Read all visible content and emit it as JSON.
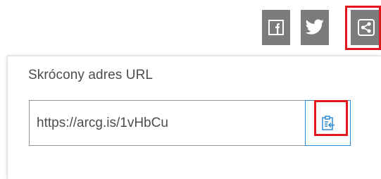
{
  "share_bar": {
    "buttons": [
      {
        "icon": "facebook-icon"
      },
      {
        "icon": "twitter-icon"
      },
      {
        "icon": "share-icon"
      }
    ],
    "button_color": "#7b7b7b"
  },
  "panel": {
    "label": "Skrócony adres URL",
    "short_url": "https://arcg.is/1vHbCu",
    "copy_icon": "clipboard-copy-icon"
  },
  "colors": {
    "highlight": "#e3151d",
    "accent": "#2d8ad6",
    "text": "#4c4c4c"
  }
}
